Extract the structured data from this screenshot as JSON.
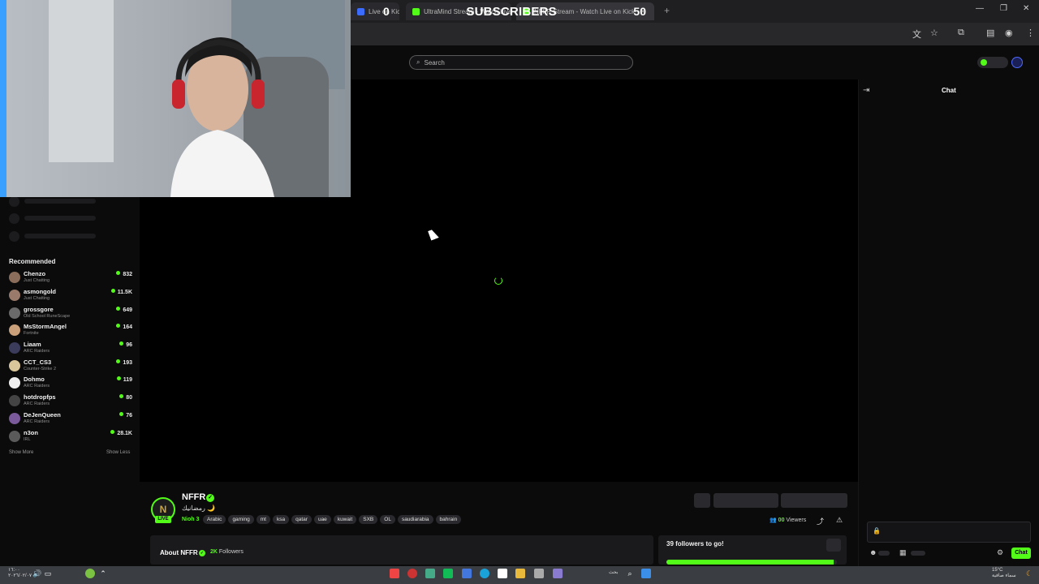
{
  "browser": {
    "tabs": [
      {
        "label": "Live on Kick",
        "favicon_color": "#3c6cff"
      },
      {
        "label": "UltraMind Stream - Watch Live on Kick",
        "favicon_color": "#53fc18"
      },
      {
        "label": "NFFR Stream - Watch Live on Kick",
        "favicon_color": "#53fc18"
      }
    ],
    "new_tab_icon": "plus-icon",
    "window_controls": [
      "minimize-icon",
      "maximize-icon",
      "close-icon"
    ],
    "toolbar_icons": [
      "translate-icon",
      "star-icon",
      "extensions-icon",
      "profile-icon",
      "menu-icon"
    ]
  },
  "overlay": {
    "subscribers_current": "0",
    "subscribers_label": "SUBSCRIBERS",
    "subscribers_goal": "50"
  },
  "search": {
    "placeholder": "Search"
  },
  "sidebar": {
    "recommended_title": "Recommended",
    "items": [
      {
        "name": "Chenzo",
        "category": "Just Chatting",
        "viewers": "832",
        "avatar_color": "#8a6d5a"
      },
      {
        "name": "asmongold",
        "category": "Just Chatting",
        "viewers": "11.5K",
        "avatar_color": "#9a7a6a"
      },
      {
        "name": "grossgore",
        "category": "Old School RuneScape",
        "viewers": "649",
        "avatar_color": "#6a6a6a"
      },
      {
        "name": "MsStormAngel",
        "category": "Fortnite",
        "viewers": "164",
        "avatar_color": "#c9a07a"
      },
      {
        "name": "Liaam",
        "category": "ARC Raiders",
        "viewers": "96",
        "avatar_color": "#3b3b5c"
      },
      {
        "name": "CCT_CS3",
        "category": "Counter-Strike 2",
        "viewers": "193",
        "avatar_color": "#d9c69a"
      },
      {
        "name": "Dohmo",
        "category": "ARC Raiders",
        "viewers": "119",
        "avatar_color": "#eeeeee"
      },
      {
        "name": "hotdropfps",
        "category": "ARC Raiders",
        "viewers": "80",
        "avatar_color": "#444444"
      },
      {
        "name": "DeJenQueen",
        "category": "ARC Raiders",
        "viewers": "76",
        "avatar_color": "#7a5a9a"
      },
      {
        "name": "n3on",
        "category": "IRL",
        "viewers": "28.1K",
        "avatar_color": "#5a5a5a"
      }
    ],
    "show_more": "Show More",
    "show_less": "Show Less"
  },
  "stream": {
    "channel_name": "NFFR",
    "title": "رمضانيك 🌙",
    "category": "Nioh 3",
    "tags": [
      "Arabic",
      "gaming",
      "mt",
      "ksa",
      "qatar",
      "uae",
      "kuwait",
      "SXB",
      "OL",
      "saudiarabia",
      "bahrain"
    ],
    "live_label": "LIVE",
    "viewers_count": "00",
    "viewers_label": "Viewers"
  },
  "about": {
    "label": "About NFFR",
    "followers_count": "2K",
    "followers_label": "Followers"
  },
  "goal": {
    "text": "39 followers to go!",
    "progress": 0.98
  },
  "chat": {
    "title": "Chat",
    "send_label": "Chat"
  },
  "taskbar": {
    "clock_date": "١٦:٠٠\n٢٠٢٦/٠٢/٠٧",
    "weather_text": "15°C\nسماء صافية",
    "search_text": "بحث"
  },
  "colors": {
    "accent": "#53fc18",
    "background": "#0b0b0c"
  }
}
